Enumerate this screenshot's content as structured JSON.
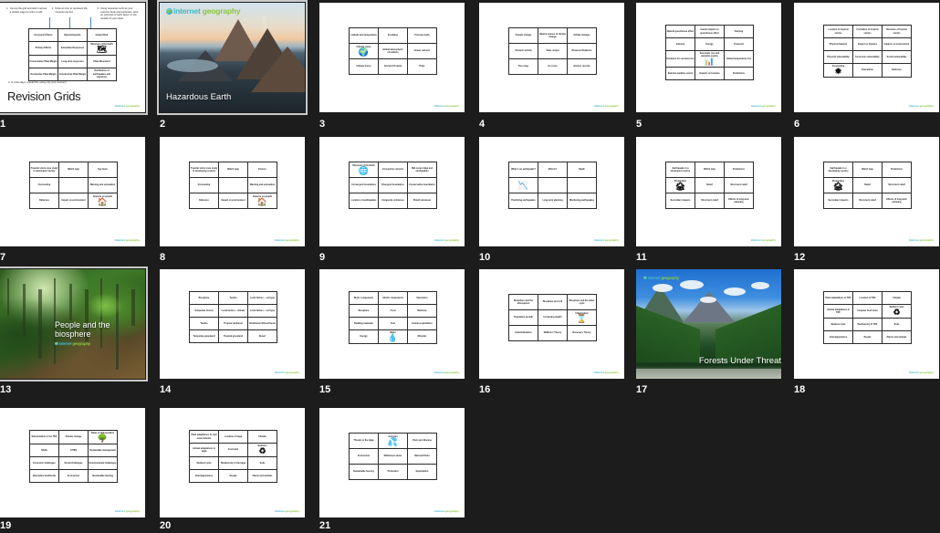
{
  "app": {
    "view": "slide-sorter",
    "background": "#1c1c1c",
    "slide_count": 21
  },
  "brand": {
    "name_part1": "internet",
    "name_part2": "geography",
    "color_teal": "#3db7c8",
    "color_green": "#8cc63f"
  },
  "slides": [
    {
      "number": "1",
      "type": "intro",
      "selected": true,
      "title": "Revision Grids",
      "instructions": [
        {
          "num": "1.",
          "text": "Cut out the grid and stick it across a double page (or print on A3)"
        },
        {
          "num": "2.",
          "text": "Draw an icon to represent the contents the box"
        },
        {
          "num": "3.",
          "text": "Using resources such as your exercise book and textbooks, write an overview of each factor on the outside of your sheet."
        }
      ],
      "step4": "4. In a few days, repeat this, using only your memory!",
      "grid": {
        "cols": 3,
        "rows": 4,
        "cells": [
          "Economic Effects",
          "Natural Hazards",
          "Hazard Risk",
          "Primary Effects",
          "Immediate Responses",
          "Structure of the Earth",
          "Conservative Plate Margin",
          "Long-term responses",
          "Plate Movement",
          "Destructive Plate Margin",
          "Constructive Plate Margin",
          "Distribution of earthquakes and volcanoes"
        ],
        "icon_cell_index": 5,
        "icon": "earth-icon"
      }
    },
    {
      "number": "2",
      "type": "title",
      "selected": true,
      "title": "Hazardous Earth",
      "scene": "volcano",
      "logo_position": "top-left"
    },
    {
      "number": "3",
      "type": "grid",
      "selected": false,
      "grid": {
        "cols": 3,
        "rows": 3,
        "cells": [
          "Latitude and temperature",
          "Insolation",
          "Pressure belts",
          "Climate zones",
          "Global atmospheric circulation",
          "Ocean currents",
          "Climate Zones",
          "Arid and Tropical",
          "Polar"
        ],
        "icon_cell_index": 3,
        "icon": "globe-currents-icon"
      }
    },
    {
      "number": "4",
      "type": "grid",
      "selected": false,
      "grid": {
        "cols": 3,
        "rows": 3,
        "cells": [
          "Climate change",
          "Natural causes of climate change",
          "Orbital changes",
          "Volcanic activity",
          "Solar output",
          "Observed Evidence",
          "Tree rings",
          "Ice cores",
          "Historic records"
        ],
        "icon_cell_index": -1,
        "icon": ""
      }
    },
    {
      "number": "5",
      "type": "grid",
      "selected": false,
      "grid": {
        "cols": 3,
        "rows": 4,
        "cells": [
          "Natural greenhouse effect",
          "Human impact on greenhouse effect",
          "Farming",
          "Industry",
          "Energy",
          "Transport",
          "Evidence for sea level rise",
          "Sea levels rise and warming oceans",
          "Global temperature rise",
          "Extreme weather events",
          "Impacts on humans",
          "Predictions"
        ],
        "icon_cell_index": 7,
        "icon": "bar-chart-icon"
      }
    },
    {
      "number": "6",
      "type": "grid",
      "selected": false,
      "grid": {
        "cols": 3,
        "rows": 4,
        "cells": [
          "Location of tropical storms",
          "Formation of tropical storms",
          "Structure of tropical storms",
          "Physical hazards",
          "Impact on humans",
          "Impacts on environment",
          "Physical vulnerability",
          "Economic vulnerability",
          "Social vulnerability",
          "Forecasting",
          "Evacuation",
          "Defences"
        ],
        "icon_cell_index": 9,
        "icon": "satellite-icon"
      }
    },
    {
      "number": "7",
      "type": "grid",
      "selected": false,
      "grid": {
        "cols": 3,
        "rows": 3,
        "cells": [
          "Tropical storm case study in developed country",
          "Watch map",
          "Key facts",
          "Forecasting",
          "",
          "Warning and evacuation",
          "Defences",
          "Impact on environment",
          "Impacts on people"
        ],
        "icon_cell_index": 8,
        "icon": "house-icon"
      }
    },
    {
      "number": "8",
      "type": "grid",
      "selected": false,
      "grid": {
        "cols": 3,
        "rows": 3,
        "cells": [
          "Tropical storm case study in developing country",
          "Watch map",
          "Factors",
          "Forecasting",
          "",
          "Warning and evacuation",
          "Defences",
          "Impact on environment",
          "Impacts on people"
        ],
        "icon_cell_index": 8,
        "icon": "house-icon"
      }
    },
    {
      "number": "9",
      "type": "grid",
      "selected": false,
      "grid": {
        "cols": 3,
        "rows": 3,
        "cells": [
          "Structure of the Earth",
          "Convection currents",
          "Mid ocean ridge and earthquakes",
          "Convergent boundaries",
          "Divergent boundaries",
          "Conservative boundaries",
          "Location of earthquakes",
          "Composite volcanoes",
          "Shield volcanoes"
        ],
        "icon_cell_index": 0,
        "icon": "earth-layers-icon"
      }
    },
    {
      "number": "10",
      "type": "grid",
      "selected": false,
      "grid": {
        "cols": 3,
        "rows": 3,
        "cells": [
          "What is an earthquake?",
          "Effects?",
          "Depth",
          "",
          "",
          "",
          "Predicting earthquakes",
          "Long-term planning",
          "Monitoring earthquakes"
        ],
        "icon_cell_index": 3,
        "icon": "seismograph-icon"
      }
    },
    {
      "number": "11",
      "type": "grid",
      "selected": false,
      "grid": {
        "cols": 3,
        "rows": 3,
        "cells": [
          "Earthquake in a developed country",
          "Watch map",
          "Predictions",
          "Preparation",
          "Relief",
          "Short-term relief",
          "Secondary impacts",
          "Short-term relief",
          "Effects of long-term planning"
        ],
        "icon_cell_index": 3,
        "icon": "earthquake-icon"
      }
    },
    {
      "number": "12",
      "type": "grid",
      "selected": false,
      "grid": {
        "cols": 3,
        "rows": 3,
        "cells": [
          "Earthquake in a developing country",
          "Watch map",
          "Predictions",
          "Preparation",
          "Relief",
          "Short-term relief",
          "Secondary impacts",
          "Short-term relief",
          "Effects of long-term planning"
        ],
        "icon_cell_index": 3,
        "icon": "earthquake-icon"
      }
    },
    {
      "number": "13",
      "type": "title",
      "selected": true,
      "title": "People and the biosphere",
      "scene": "jungle",
      "logo_position": "under-title"
    },
    {
      "number": "14",
      "type": "grid",
      "selected": false,
      "grid": {
        "cols": 3,
        "rows": 4,
        "cells": [
          "Biosphere",
          "Tundra",
          "Local factors – soil type",
          "Temperate forests",
          "Local factors – climate",
          "Local factors – soil type",
          "Tundra",
          "Tropical rainforest",
          "Distribution Boreal forest",
          "Temperate grassland",
          "Tropical grassland",
          "Desert"
        ],
        "icon_cell_index": -1,
        "icon": ""
      }
    },
    {
      "number": "15",
      "type": "grid",
      "selected": false,
      "grid": {
        "cols": 3,
        "rows": 4,
        "cells": [
          "Biotic components",
          "Abiotic components",
          "Interaction",
          "Biosphere",
          "Food",
          "Medicine",
          "Building materials",
          "Fuel",
          "Human exploitation",
          "Energy",
          "Water",
          "Minerals"
        ],
        "icon_cell_index": 10,
        "icon": "water-drop-icon"
      }
    },
    {
      "number": "16",
      "type": "grid",
      "selected": false,
      "grid": {
        "cols": 3,
        "rows": 3,
        "cells": [
          "Biosphere and the atmosphere",
          "Biosphere and soil",
          "Biosphere and the water cycle",
          "Population growth",
          "Increasing wealth",
          "Urbanisation",
          "Industrialisation",
          "Malthus's Theory",
          "Boserup's Theory"
        ],
        "icon_cell_index": 5,
        "icon": "hourglass-icon"
      }
    },
    {
      "number": "17",
      "type": "title",
      "selected": false,
      "title": "Forests Under Threat",
      "scene": "forest",
      "logo_position": "top-left-small"
    },
    {
      "number": "18",
      "type": "grid",
      "selected": false,
      "grid": {
        "cols": 3,
        "rows": 4,
        "cells": [
          "Plant adaptations in TRF",
          "Location of TRF",
          "Climate",
          "Animal adaptations in TRF",
          "Complex food webs",
          "Nutrient cycle",
          "Nutrient cycle",
          "Biodiversity in TRF",
          "Soils",
          "Interdependence",
          "People",
          "Plants and animals"
        ],
        "icon_cell_index": 5,
        "icon": "nutrient-cycle-icon"
      }
    },
    {
      "number": "19",
      "type": "grid",
      "selected": false,
      "grid": {
        "cols": 3,
        "rows": 4,
        "cells": [
          "Deforestation in the TRF",
          "Climate change",
          "Rates of deforestation",
          "NGOs",
          "CITES",
          "Sustainable management",
          "Economic challenges",
          "Social challenges",
          "Environmental challenges",
          "Alternative livelihoods",
          "Ecotourism",
          "Sustainable farming"
        ],
        "icon_cell_index": 2,
        "icon": "deforestation-icon"
      }
    },
    {
      "number": "20",
      "type": "grid",
      "selected": false,
      "grid": {
        "cols": 3,
        "rows": 4,
        "cells": [
          "Plant adaptations in cold environments",
          "Location of taiga",
          "Climate",
          "Animal adaptations in taiga",
          "Food web",
          "Nutrition",
          "Nutrient cycle",
          "Biodiversity in the taiga",
          "Soils",
          "Interdependence",
          "People",
          "Plants and animals"
        ],
        "icon_cell_index": 5,
        "icon": "nutrient-cycle-icon"
      }
    },
    {
      "number": "21",
      "type": "grid",
      "selected": false,
      "grid": {
        "cols": 3,
        "rows": 3,
        "cells": [
          "Threats to the taiga",
          "Acid rain",
          "Pests and disease",
          "Ecotourism",
          "Wilderness areas",
          "National Parks",
          "Sustainable forestry",
          "Protection",
          "Exploitation"
        ],
        "icon_cell_index": 1,
        "icon": "acid-rain-drop-icon"
      }
    }
  ]
}
